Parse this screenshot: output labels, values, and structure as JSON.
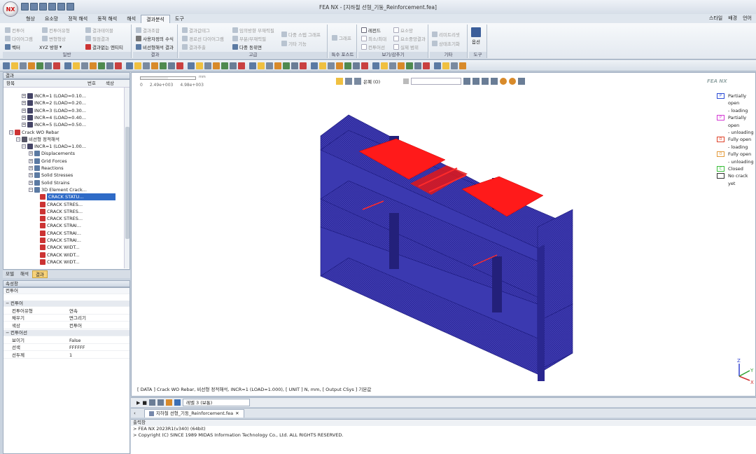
{
  "app": {
    "title": "FEA NX - [지하철 선형_기둥_Reinforcement.fea]",
    "logo_text": "NX"
  },
  "menu": {
    "tabs": [
      "형상",
      "요소망",
      "정적 해석",
      "동적 해석",
      "해석",
      "결과분석",
      "도구"
    ],
    "active_index": 5,
    "right": [
      "스타일",
      "배경",
      "언어"
    ]
  },
  "ribbon": {
    "groups": [
      "일반",
      "결과",
      "고급",
      "특수 포스트",
      "보기/감추기",
      "기타",
      "도구"
    ],
    "general": {
      "contour": "컨투어",
      "diagram": "다이어그램",
      "vector": "벡터",
      "contour_type": "컨투어유형",
      "deform_type": "변형형상",
      "xyz": "XYZ 방향",
      "result_table": "결과테이블",
      "node_result": "절점결과",
      "result_entity": "결과없는 엔티티"
    },
    "result": {
      "result_combo": "결과조합",
      "user_formula": "사용자정의 수식",
      "nonlinear": "비선형해석 결과"
    },
    "advanced": {
      "extract": "결과값테그",
      "extract2": "결과추출",
      "iso": "임의방향 부재력필",
      "path": "경로선 다이어그램",
      "clip": "부분/부재력필",
      "multi_step": "다중 스텝 그래프",
      "other": "기타 기능",
      "multi_view": "다중 동위면"
    },
    "special": {
      "graph": "그래프"
    },
    "show_hide": {
      "legend": "레전드",
      "min_max": "최소/최대",
      "contour_line": "컨투어선",
      "mesh": "요소망",
      "node_value": "요소중앙결과",
      "actual_range": "실제 범위"
    },
    "misc": {
      "reset": "리미트리셋",
      "status": "상태초기화"
    },
    "tools": {
      "options": "옵션"
    }
  },
  "left_panel": {
    "header": "결과",
    "columns": [
      "항목",
      "번호",
      "색상"
    ],
    "tree": [
      {
        "level": 2,
        "label": "INCR=1 (LOAD=0.10..."
      },
      {
        "level": 2,
        "label": "INCR=2 (LOAD=0.20..."
      },
      {
        "level": 2,
        "label": "INCR=3 (LOAD=0.30..."
      },
      {
        "level": 2,
        "label": "INCR=4 (LOAD=0.40..."
      },
      {
        "level": 2,
        "label": "INCR=5 (LOAD=0.50..."
      },
      {
        "level": 0,
        "label": "Crack WO Rebar"
      },
      {
        "level": 1,
        "label": "비선형 정적해석"
      },
      {
        "level": 2,
        "label": "INCR=1 (LOAD=1.00..."
      },
      {
        "level": 3,
        "label": "Displacements"
      },
      {
        "level": 3,
        "label": "Grid Forces"
      },
      {
        "level": 3,
        "label": "Reactions"
      },
      {
        "level": 3,
        "label": "Solid Stresses"
      },
      {
        "level": 3,
        "label": "Solid Strains"
      },
      {
        "level": 3,
        "label": "3D Element Crack..."
      },
      {
        "level": 4,
        "label": "CRACK STATU..."
      },
      {
        "level": 4,
        "label": "CRACK STRES..."
      },
      {
        "level": 4,
        "label": "CRACK STRES..."
      },
      {
        "level": 4,
        "label": "CRACK STRES..."
      },
      {
        "level": 4,
        "label": "CRACK STRAI..."
      },
      {
        "level": 4,
        "label": "CRACK STRAI..."
      },
      {
        "level": 4,
        "label": "CRACK STRAI..."
      },
      {
        "level": 4,
        "label": "CRACK WIDT..."
      },
      {
        "level": 4,
        "label": "CRACK WIDT..."
      },
      {
        "level": 4,
        "label": "CRACK WIDT..."
      }
    ],
    "bottom_tabs": [
      "모델",
      "해석",
      "결과"
    ],
    "active_tab": 2
  },
  "properties": {
    "header": "속성창",
    "subheader": "컨투어",
    "rows": [
      {
        "type": "cat",
        "key": "컨투어"
      },
      {
        "type": "row",
        "key": "컨투어유형",
        "value": "연속"
      },
      {
        "type": "row",
        "key": "채우기",
        "value": "면그리기"
      },
      {
        "type": "row",
        "key": "색상",
        "value": "컨투어"
      },
      {
        "type": "cat",
        "key": "컨투어선"
      },
      {
        "type": "row",
        "key": "보이기",
        "value": "False"
      },
      {
        "type": "row",
        "key": "선색",
        "value": "FFFFFF"
      },
      {
        "type": "row",
        "key": "선두께",
        "value": "1"
      }
    ]
  },
  "viewport": {
    "scale": {
      "left": "0",
      "mid": "2.49e+003",
      "right": "4.98e+003",
      "unit": "mm"
    },
    "view_label": "은폐 (O)",
    "brand": "FEA NX",
    "legend": [
      {
        "code": "P",
        "lines": [
          "Partially open",
          "- loading"
        ],
        "color": "#2a4bd6"
      },
      {
        "code": "P",
        "lines": [
          "Partially open",
          "- unloading"
        ],
        "color": "#d43ad4"
      },
      {
        "code": "O",
        "lines": [
          "Fully open",
          "- loading"
        ],
        "color": "#e0442b"
      },
      {
        "code": "O",
        "lines": [
          "Fully open",
          "- unloading"
        ],
        "color": "#e39a3a"
      },
      {
        "code": "C",
        "lines": [
          "Closed"
        ],
        "color": "#3bbf3b"
      },
      {
        "code": "",
        "lines": [
          "No crack yet"
        ],
        "color": "#333333"
      }
    ],
    "info": "[ DATA ] Crack WO Rebar, 비선형 정적해석, INCR=1 (LOAD=1.000), [ UNIT ] N, mm, [ Output CSys ] 기본값",
    "axes": {
      "x": "X",
      "y": "Y",
      "z": "Z"
    },
    "colors": {
      "mesh": "#2d2aa0",
      "crack": "#ff1a1a",
      "edge": "#1b197a"
    }
  },
  "animation": {
    "step_label": "레벨 3 (보통)"
  },
  "file_tab": "지하철 선형_기둥_Reinforcement.fea",
  "output": {
    "header": "출력창",
    "lines": [
      "> FEA NX 2023R1(v340) (64bit)",
      "> Copyright (C) SINCE 1989 MIDAS Information Technology Co., Ltd. ALL RIGHTS RESERVED."
    ]
  }
}
